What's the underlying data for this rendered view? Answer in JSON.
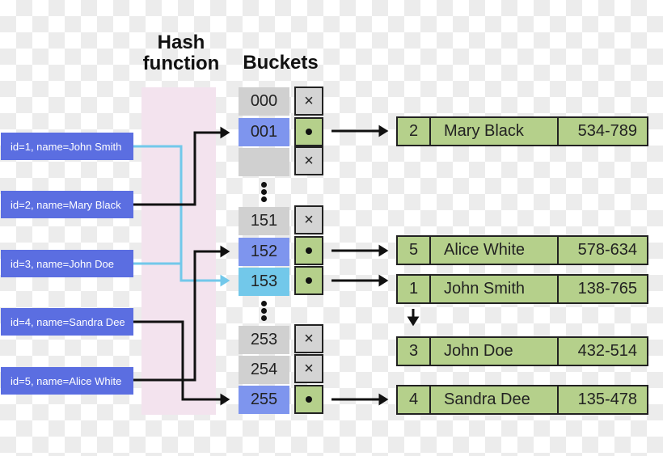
{
  "headings": {
    "hash_function": "Hash function",
    "buckets": "Buckets"
  },
  "keys": [
    {
      "label": "id=1, name=John Smith",
      "target_bucket": "153",
      "link_color": "#72c8ea"
    },
    {
      "label": "id=2, name=Mary Black",
      "target_bucket": "001",
      "link_color": "#111111"
    },
    {
      "label": "id=3, name=John Doe",
      "target_bucket": "153",
      "link_color": "#72c8ea"
    },
    {
      "label": "id=4, name=Sandra Dee",
      "target_bucket": "255",
      "link_color": "#111111"
    },
    {
      "label": "id=5, name=Alice White",
      "target_bucket": "152",
      "link_color": "#111111"
    }
  ],
  "buckets": [
    {
      "index": "000",
      "state": "empty",
      "pointer": "×"
    },
    {
      "index": "001",
      "state": "used",
      "pointer": "•"
    },
    {
      "index": "",
      "state": "empty",
      "pointer": "×"
    },
    {
      "index": "151",
      "state": "empty",
      "pointer": "×"
    },
    {
      "index": "152",
      "state": "used",
      "pointer": "•"
    },
    {
      "index": "153",
      "state": "collision",
      "pointer": "•"
    },
    {
      "index": "253",
      "state": "empty",
      "pointer": "×"
    },
    {
      "index": "254",
      "state": "empty",
      "pointer": "×"
    },
    {
      "index": "255",
      "state": "used",
      "pointer": "•"
    }
  ],
  "ellipsis": "⋮",
  "records": [
    {
      "id": "2",
      "name": "Mary Black",
      "phone": "534-789",
      "bucket": "001"
    },
    {
      "id": "5",
      "name": "Alice White",
      "phone": "578-634",
      "bucket": "152"
    },
    {
      "id": "1",
      "name": "John Smith",
      "phone": "138-765",
      "bucket": "153"
    },
    {
      "id": "3",
      "name": "John Doe",
      "phone": "432-514",
      "bucket": "153",
      "chained_from": "1"
    },
    {
      "id": "4",
      "name": "Sandra Dee",
      "phone": "135-478",
      "bucket": "255"
    }
  ],
  "colors": {
    "key_box": "#5b6ee1",
    "bucket_empty": "#d0d0d0",
    "bucket_used": "#7e95ee",
    "bucket_collision": "#72c8ea",
    "record_fill": "#b5d08b",
    "hash_band": "#f3e3ee"
  }
}
